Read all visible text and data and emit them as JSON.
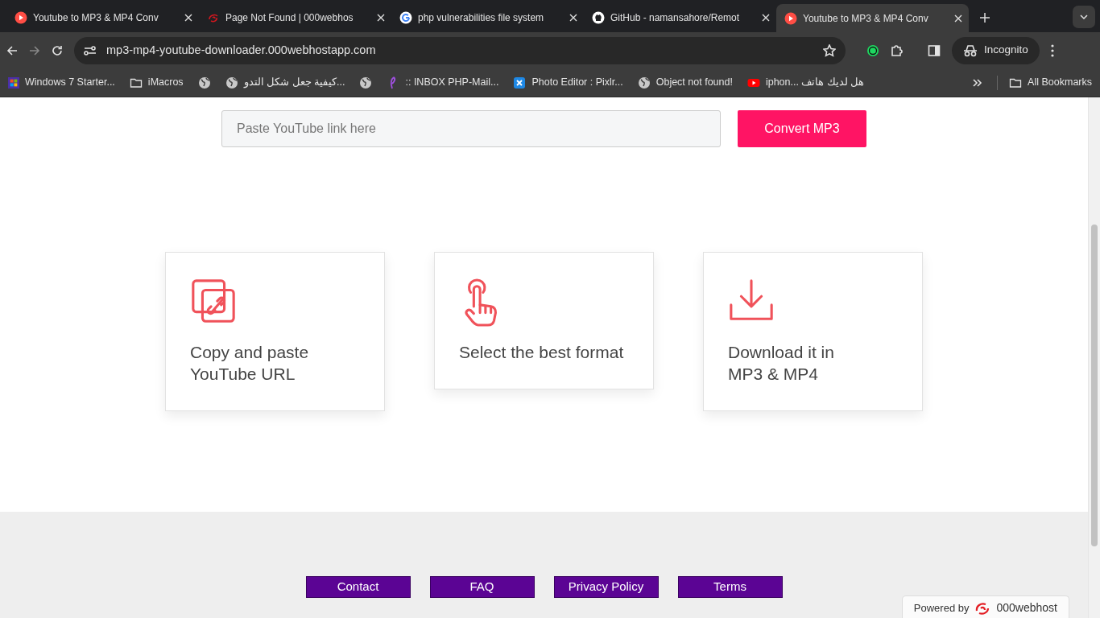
{
  "tabs": [
    {
      "title": "Youtube to MP3 & MP4 Conv",
      "kind": "play",
      "selected": false
    },
    {
      "title": "Page Not Found | 000webhos",
      "kind": "swirl",
      "selected": false
    },
    {
      "title": "php vulnerabilities file system",
      "kind": "google",
      "selected": false
    },
    {
      "title": "GitHub - namansahore/Remot",
      "kind": "github",
      "selected": false
    },
    {
      "title": "Youtube to MP3 & MP4 Conv",
      "kind": "play",
      "selected": true
    }
  ],
  "address": "mp3-mp4-youtube-downloader.000webhostapp.com",
  "incognito": "Incognito",
  "bookmarks": [
    {
      "label": "Windows 7 Starter...",
      "kind": "windows"
    },
    {
      "label": "iMacros",
      "kind": "folder"
    },
    {
      "kind": "globe"
    },
    {
      "label": "كيفية جعل شكل التدو...",
      "kind": "globe"
    },
    {
      "kind": "globe"
    },
    {
      "label": ":: INBOX PHP-Mail...",
      "kind": "feather"
    },
    {
      "label": "Photo Editor : Pixlr...",
      "kind": "pixlr"
    },
    {
      "label": "Object not found!",
      "kind": "globe"
    },
    {
      "label": "iphon... هل لديك هاتف",
      "kind": "youtube"
    }
  ],
  "all_bookmarks": "All Bookmarks",
  "search": {
    "placeholder": "Paste YouTube link here",
    "button": "Convert MP3"
  },
  "steps": [
    {
      "kind": "copy-link",
      "lines": [
        "Copy and paste",
        "YouTube URL"
      ]
    },
    {
      "kind": "tap",
      "lines": [
        "Select the best format"
      ]
    },
    {
      "kind": "download",
      "lines": [
        "Download it in",
        "MP3 & MP4"
      ]
    }
  ],
  "footer_links": [
    "Contact",
    "FAQ",
    "Privacy Policy",
    "Terms"
  ],
  "powered_by": {
    "prefix": "Powered by",
    "brand": "000webhost"
  }
}
